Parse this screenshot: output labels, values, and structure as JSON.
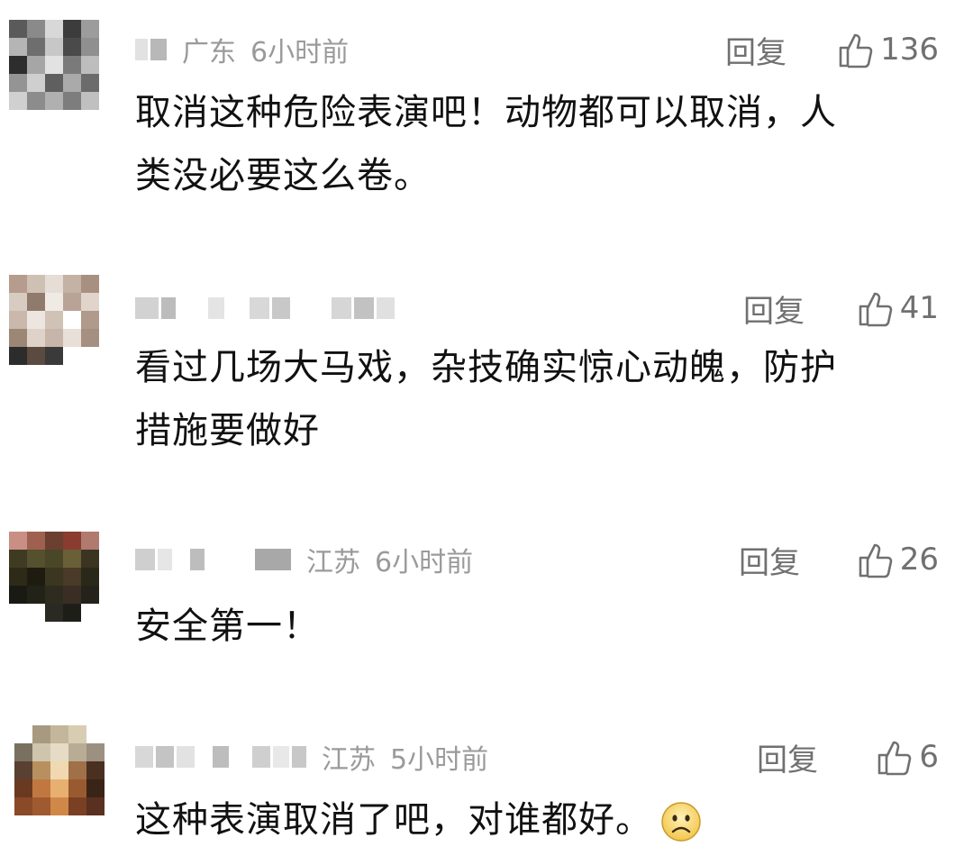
{
  "comments": [
    {
      "location": "广东",
      "time": "6小时前",
      "reply_label": "回复",
      "likes": "136",
      "text_lines": [
        "取消这种危险表演吧！动物都可以取消，人",
        "类没必要这么卷。"
      ],
      "avatar_colors": [
        "#5a5a5a",
        "#8a8a8a",
        "#d8d8d8",
        "#3c3c3c",
        "#9c9c9c",
        "#b5b5b5",
        "#6e6e6e",
        "#c7c7c7",
        "#4a4a4a",
        "#8f8f8f",
        "#2d2d2d",
        "#a6a6a6",
        "#e2e2e2",
        "#7a7a7a",
        "#bdbdbd",
        "#949494",
        "#cfcfcf",
        "#5f5f5f",
        "#aaaaaa",
        "#6b6b6b",
        "#d0d0d0",
        "#8c8c8c",
        "#b0b0b0",
        "#7d7d7d",
        "#c0c0c0"
      ]
    },
    {
      "location": "",
      "time": "",
      "reply_label": "回复",
      "likes": "41",
      "text_lines": [
        "看过几场大马戏，杂技确实惊心动魄，防护",
        "措施要做好"
      ],
      "avatar_colors": [
        "#b59c8c",
        "#cfc0b4",
        "#e6ddd6",
        "#c4b2a4",
        "#a89080",
        "#d8cbc1",
        "#8f7a6c",
        "#f0eae5",
        "#b8a396",
        "#e0d4cb",
        "#c9b8ab",
        "#ede6e0",
        "#d1c2b6",
        "#ffffff",
        "#b09a8b",
        "#9c8676",
        "#dfd3c9",
        "#c6b5a8",
        "#e8dfd8",
        "#a58f80",
        "#2c2c2c",
        "#5a4a40",
        "#3a3a3a",
        "#ffffff",
        "#ffffff"
      ]
    },
    {
      "location": "江苏",
      "time": "6小时前",
      "reply_label": "回复",
      "likes": "26",
      "text_lines": [
        "安全第一！"
      ],
      "avatar_colors": [
        "#c98f84",
        "#a06050",
        "#6b4030",
        "#8a3c30",
        "#b07a6e",
        "#3f3a22",
        "#55502e",
        "#4a4628",
        "#6a6038",
        "#3a3420",
        "#2e2a18",
        "#1e1c10",
        "#3a3620",
        "#4a3a28",
        "#2a2818",
        "#1a1a14",
        "#222218",
        "#2e2c1e",
        "#3a2e24",
        "#24221a",
        "#ffffff",
        "#ffffff",
        "#2a2a22",
        "#1e1e18",
        "#ffffff"
      ]
    },
    {
      "location": "江苏",
      "time": "5小时前",
      "reply_label": "回复",
      "likes": "6",
      "text_lines": [
        "这种表演取消了吧，对谁都好。"
      ],
      "avatar_colors": [
        "#ffffff",
        "#a89a80",
        "#c4b69a",
        "#d8ccb2",
        "#ffffff",
        "#7a7060",
        "#cfc4ac",
        "#e6dcc6",
        "#b8ac94",
        "#9c9080",
        "#5a4030",
        "#b89060",
        "#f0d8b0",
        "#a07048",
        "#4a3020",
        "#6a3a20",
        "#c07840",
        "#e8b070",
        "#9a5a30",
        "#3a2418",
        "#8a4a28",
        "#a05a30",
        "#d08848",
        "#7a4024",
        "#5a3020"
      ]
    }
  ],
  "like_icon": "thumbs-up-icon",
  "emoji_icon": "frowning-face-emoji"
}
